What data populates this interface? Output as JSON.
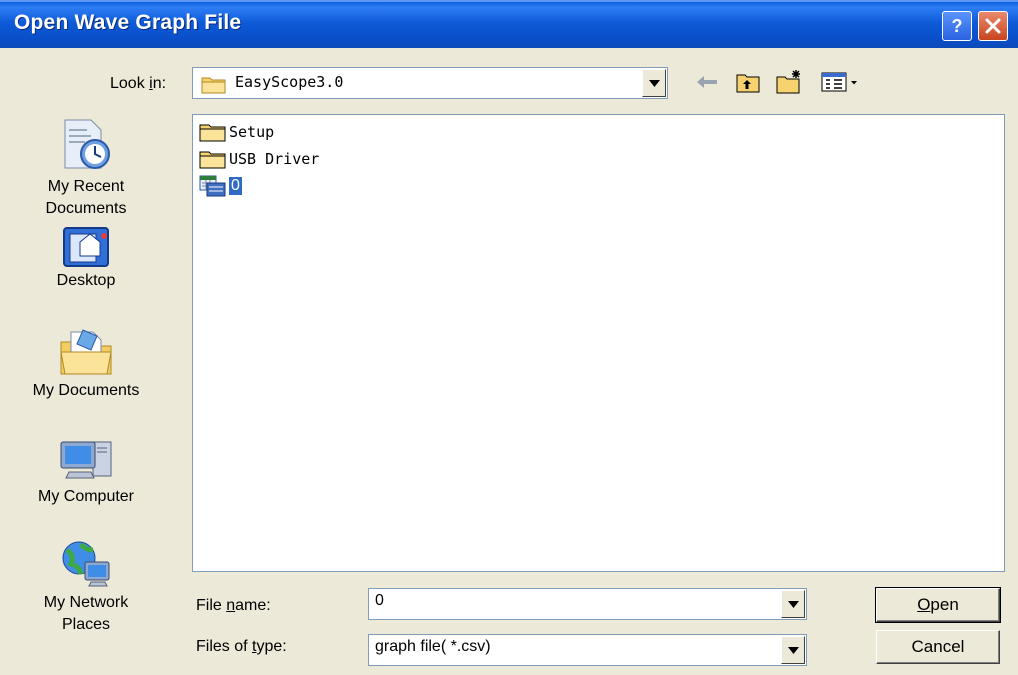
{
  "window": {
    "title": "Open Wave Graph File",
    "help_label": "?",
    "close_label": "×"
  },
  "look_in": {
    "label_pre": "Look ",
    "label_accel": "i",
    "label_post": "n:",
    "value": "EasyScope3.0"
  },
  "places": [
    {
      "label": "My Recent Documents",
      "icon": "recent-documents-icon"
    },
    {
      "label": "Desktop",
      "icon": "desktop-icon"
    },
    {
      "label": "My Documents",
      "icon": "my-documents-icon"
    },
    {
      "label": "My Computer",
      "icon": "my-computer-icon"
    },
    {
      "label": "My Network Places",
      "icon": "network-places-icon"
    }
  ],
  "files": [
    {
      "name": "Setup",
      "type": "folder"
    },
    {
      "name": "USB Driver",
      "type": "folder"
    },
    {
      "name": "0",
      "type": "csv",
      "selected": true
    }
  ],
  "file_name": {
    "label_pre": "File ",
    "label_accel": "n",
    "label_post": "ame:",
    "value": "0"
  },
  "file_type": {
    "label_pre": "Files of ",
    "label_accel": "t",
    "label_post": "ype:",
    "value": "graph file( *.csv)"
  },
  "buttons": {
    "open_accel": "O",
    "open_rest": "pen",
    "cancel": "Cancel"
  },
  "colors": {
    "titlebar": "#0a4fc8",
    "selection": "#316ac5",
    "dialog_bg": "#ece9d8"
  }
}
